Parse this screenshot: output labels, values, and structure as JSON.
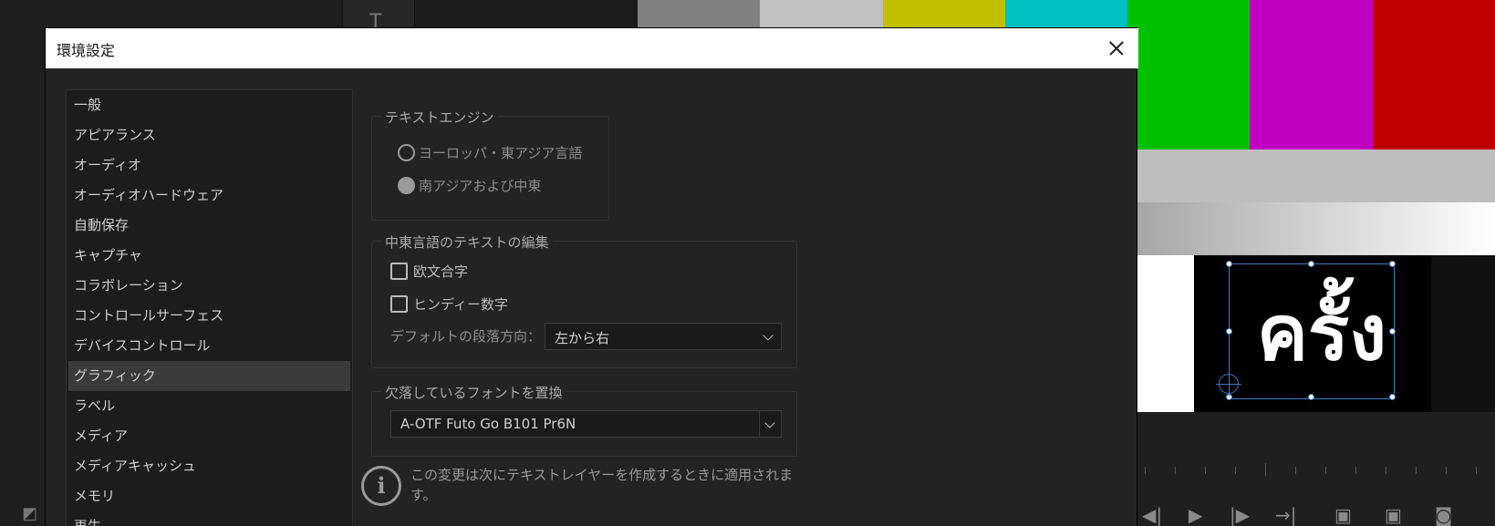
{
  "dialog": {
    "title": "環境設定",
    "categories": [
      "一般",
      "アピアランス",
      "オーディオ",
      "オーディオハードウェア",
      "自動保存",
      "キャプチャ",
      "コラボレーション",
      "コントロールサーフェス",
      "デバイスコントロール",
      "グラフィック",
      "ラベル",
      "メディア",
      "メディアキャッシュ",
      "メモリ",
      "再生"
    ],
    "selected_category": "グラフィック",
    "text_engine": {
      "title": "テキストエンジン",
      "options": [
        "ヨーロッパ・東アジア言語",
        "南アジアおよび中東"
      ],
      "selected": "南アジアおよび中東"
    },
    "middle_east": {
      "title": "中東言語のテキストの編集",
      "checkbox_ligature": "欧文合字",
      "checkbox_hindi": "ヒンディー数字",
      "direction_label": "デフォルトの段落方向：",
      "direction_value": "左から右"
    },
    "missing_font": {
      "title": "欠落しているフォントを置換",
      "font_value": "A-OTF Futo Go B101 Pr6N"
    },
    "info_lines": [
      "この変更は次にテキストレイヤーを作成するときに適用されま",
      "す。"
    ]
  },
  "background": {
    "preview_text": "ครั้ง",
    "color_bars": [
      "#808080",
      "#c0c0c0",
      "#c0c000",
      "#00c0c0",
      "#00c000",
      "#c000c0",
      "#c00000"
    ]
  }
}
